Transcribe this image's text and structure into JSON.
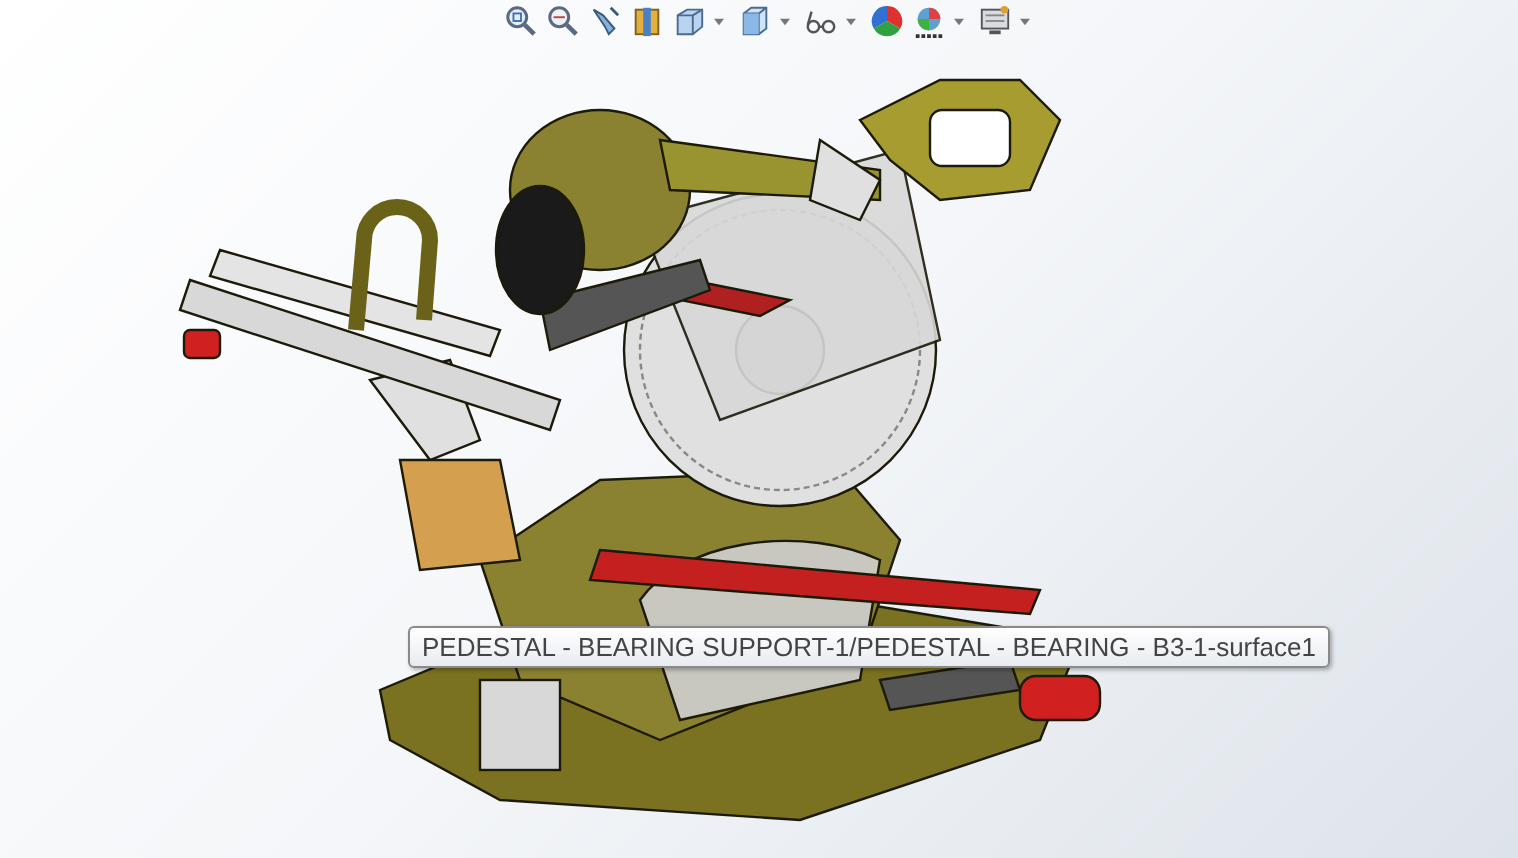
{
  "viewport": {
    "tooltip": "PEDESTAL - BEARING SUPPORT-1/PEDESTAL - BEARING - B3-1-surface1"
  }
}
